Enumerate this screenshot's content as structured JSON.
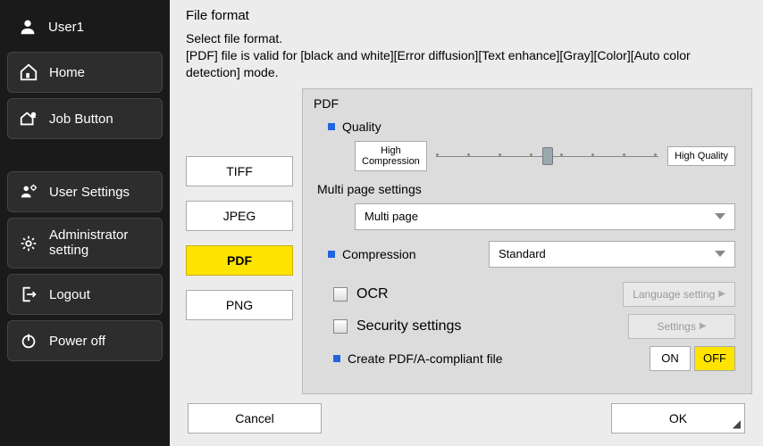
{
  "sidebar": {
    "user": "User1",
    "home": "Home",
    "job": "Job Button",
    "usersettings": "User Settings",
    "admin": "Administrator setting",
    "logout": "Logout",
    "poweroff": "Power off"
  },
  "title": "File format",
  "help": "Select file format.\n[PDF] file is valid for [black and white][Error diffusion][Text enhance][Gray][Color][Auto color detection] mode.",
  "formats": {
    "tiff": "TIFF",
    "jpeg": "JPEG",
    "pdf": "PDF",
    "png": "PNG",
    "selected": "PDF"
  },
  "panel": {
    "title": "PDF",
    "quality_label": "Quality",
    "high_compression": "High\nCompression",
    "high_quality": "High Quality",
    "slider_value": 4,
    "slider_steps": 8,
    "multipage_label": "Multi page settings",
    "multipage_value": "Multi page",
    "compression_label": "Compression",
    "compression_value": "Standard",
    "ocr_label": "OCR",
    "ocr_btn": "Language setting",
    "security_label": "Security settings",
    "security_btn": "Settings",
    "pdfa_label": "Create PDF/A-compliant file",
    "on": "ON",
    "off": "OFF",
    "pdfa_value": "OFF"
  },
  "footer": {
    "cancel": "Cancel",
    "ok": "OK"
  }
}
